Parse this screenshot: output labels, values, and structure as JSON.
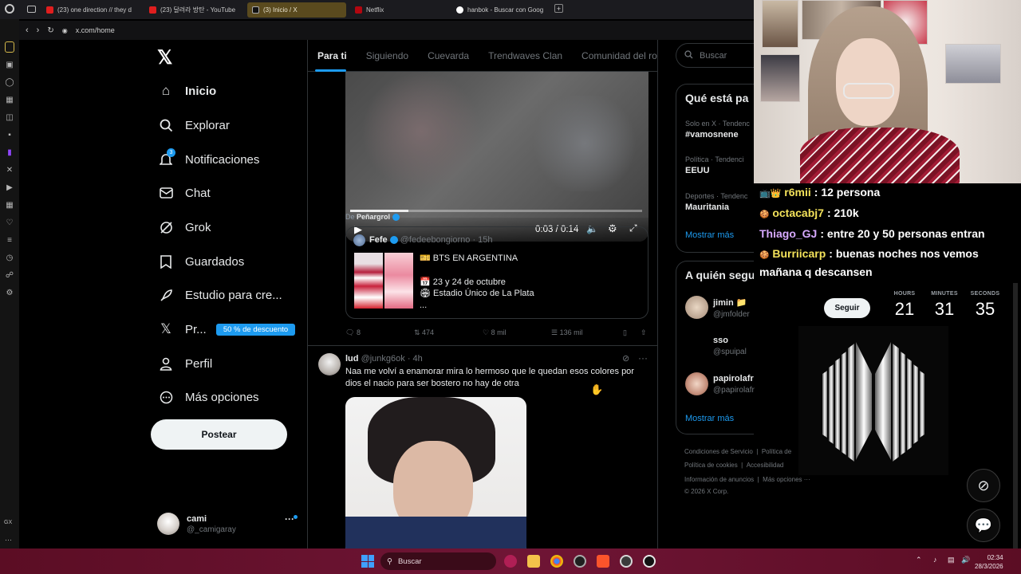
{
  "browser": {
    "tabs": [
      {
        "label": "(23) one direction // they d",
        "icon": "youtube-icon"
      },
      {
        "label": "(23) 달려라 방탄 - YouTube",
        "icon": "youtube-icon"
      },
      {
        "label": "(3) Inicio / X",
        "icon": "x-icon"
      },
      {
        "label": "Netflix",
        "icon": "netflix-icon"
      },
      {
        "label": "hanbok - Buscar con Goog",
        "icon": "google-icon"
      }
    ],
    "new_tab": "+",
    "url": "x.com/home"
  },
  "nav": {
    "items": [
      {
        "label": "Inicio",
        "icon": "home-icon"
      },
      {
        "label": "Explorar",
        "icon": "search-icon"
      },
      {
        "label": "Notificaciones",
        "icon": "bell-icon"
      },
      {
        "label": "Chat",
        "icon": "mail-icon"
      },
      {
        "label": "Grok",
        "icon": "grok-icon"
      },
      {
        "label": "Guardados",
        "icon": "bookmark-icon"
      },
      {
        "label": "Estudio para cre...",
        "icon": "rocket-icon"
      },
      {
        "label": "Pr...",
        "icon": "x-premium-icon"
      },
      {
        "label": "Perfil",
        "icon": "person-icon"
      },
      {
        "label": "Más opciones",
        "icon": "more-circle-icon"
      }
    ],
    "notif_count": "3",
    "premium_badge": "50 % de descuento",
    "post_label": "Postear",
    "account": {
      "name": "cami",
      "handle": "@_camigaray",
      "more": "···"
    }
  },
  "feed": {
    "tabs": [
      "Para ti",
      "Siguiendo",
      "Cuevarda",
      "Trendwaves Clan",
      "Comunidad del rocke"
    ],
    "video": {
      "time": "0:03 / 0:14",
      "progress": 0.2
    },
    "source_prefix": "De",
    "source_name": "Peñargrol",
    "quote": {
      "name": "Fefe",
      "handle": "@fedeebongiorno",
      "time": "· 15h",
      "lines": [
        "🎫 BTS EN ARGENTINA",
        "📅 23 y 24 de octubre",
        "🏟 Estadio Único de La Plata",
        "..."
      ]
    },
    "actions": {
      "replies": "8",
      "reposts": "474",
      "likes": "8 mil",
      "views": "136 mil"
    },
    "tweet2": {
      "name": "lud",
      "handle": "@junkg6ok",
      "time": "· 4h",
      "text": "Naa me volví a enamorar mira lo hermoso que le quedan esos colores por dios el nacio para ser bostero no hay de otra"
    }
  },
  "right": {
    "search_placeholder": "Buscar",
    "trends_title": "Qué está pa",
    "trends": [
      {
        "meta": "Solo en X · Tendenc",
        "name": "#vamosnene"
      },
      {
        "meta": "Política · Tendenci",
        "name": "EEUU"
      },
      {
        "meta": "Deportes · Tendenc",
        "name": "Mauritania"
      }
    ],
    "show_more": "Mostrar más",
    "follow_title": "A quién segu",
    "follow": [
      {
        "name": "jimin 📁",
        "handle": "@jmfolder"
      },
      {
        "name": "sso",
        "handle": "@spuipal"
      },
      {
        "name": "papirolafr",
        "handle": "@papirolafr"
      }
    ],
    "follow_button": "Seguir",
    "footer": [
      "Condiciones de Servicio",
      "|",
      "Política de",
      "Política de cookies",
      "|",
      "Accesibilidad",
      "Información de anuncios",
      "|",
      "Más opciones ···",
      "© 2026 X Corp."
    ]
  },
  "stream": {
    "chat": [
      {
        "user": "r6mii",
        "msg": ": 12 persona",
        "color": "#f2e15a",
        "badge": "📺👑"
      },
      {
        "user": "octacabj7",
        "msg": ": 210k",
        "color": "#f2e15a",
        "badge": "🍪"
      },
      {
        "user": "Thiago_GJ",
        "msg": ": entre 20 y 50 personas entran",
        "color": "#d7a9ff",
        "badge": ""
      },
      {
        "user": "Burriicarp",
        "msg": ": buenas noches nos vemos",
        "color": "#f2e15a",
        "badge": "🍪"
      },
      {
        "user": "",
        "msg": "mañana q descansen",
        "color": "#ffffff",
        "badge": ""
      }
    ],
    "timer": {
      "labels": [
        "HOURS",
        "MINUTES",
        "SECONDS"
      ],
      "values": [
        "21",
        "31",
        "35"
      ]
    }
  },
  "taskbar": {
    "search": "Buscar",
    "time": "02:34",
    "date": "28/3/2026"
  },
  "colors": {
    "accent": "#1d9bf0",
    "taskbar": "#6f1535"
  }
}
